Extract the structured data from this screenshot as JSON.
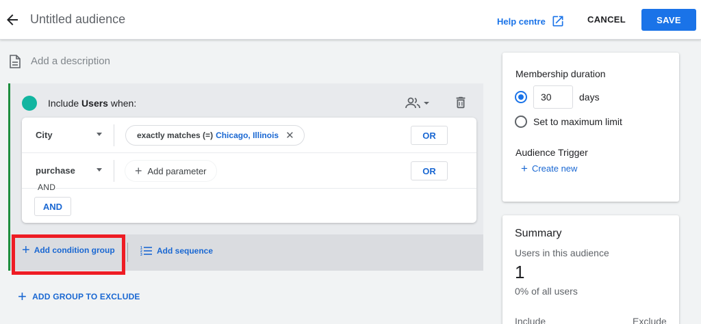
{
  "header": {
    "title": "Untitled audience",
    "help_label": "Help centre",
    "cancel_label": "CANCEL",
    "save_label": "SAVE"
  },
  "description": {
    "placeholder": "Add a description"
  },
  "include_group": {
    "prefix": "Include",
    "scope": "Users",
    "suffix": "when:",
    "conditions": [
      {
        "field": "City",
        "operator": "exactly matches (=)",
        "value": "Chicago, Illinois",
        "or_label": "OR"
      },
      {
        "field": "purchase",
        "add_parameter_label": "Add parameter",
        "or_label": "OR"
      }
    ],
    "and_separator": "AND",
    "and_button": "AND",
    "add_condition_group": "Add condition group",
    "add_sequence": "Add sequence"
  },
  "add_group_to_exclude": "ADD GROUP TO EXCLUDE",
  "membership": {
    "title": "Membership duration",
    "days_value": "30",
    "days_label": "days",
    "max_limit_label": "Set to maximum limit",
    "selected_option": "days",
    "trigger_title": "Audience Trigger",
    "create_new_label": "Create new"
  },
  "summary": {
    "title": "Summary",
    "users_label": "Users in this audience",
    "count": "1",
    "percent_label": "0% of all users",
    "include_label": "Include",
    "exclude_label": "Exclude"
  },
  "colors": {
    "accent": "#1a73e8",
    "link": "#1967d2",
    "group_dot": "#12b5a0",
    "highlight_box": "#ee1c24"
  }
}
